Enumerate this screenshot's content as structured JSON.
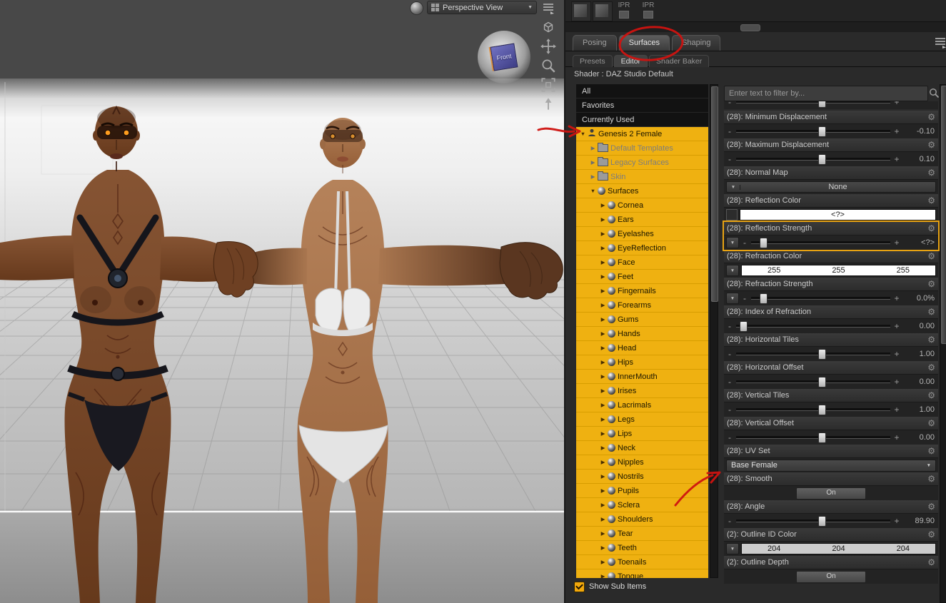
{
  "viewport": {
    "view_label": "Perspective View",
    "cube_label": "Front",
    "tools": [
      "cube-control",
      "pan",
      "zoom",
      "frame",
      "aim"
    ]
  },
  "toolbar": {
    "ipr_buttons": [
      "IPR",
      "IPR"
    ]
  },
  "tabs": [
    {
      "label": "Posing",
      "active": false
    },
    {
      "label": "Surfaces",
      "active": true
    },
    {
      "label": "Shaping",
      "active": false
    }
  ],
  "subtabs": [
    {
      "label": "Presets",
      "active": false
    },
    {
      "label": "Editor",
      "active": true
    },
    {
      "label": "Shader Baker",
      "active": false
    }
  ],
  "shader_label": "Shader : DAZ Studio Default",
  "filter_placeholder": "Enter text to filter by...",
  "tree": {
    "filters": [
      "All",
      "Favorites",
      "Currently Used"
    ],
    "root_label": "Genesis 2 Female",
    "groups": [
      "Default Templates",
      "Legacy Surfaces",
      "Skin"
    ],
    "surfaces_label": "Surfaces",
    "surfaces": [
      "Cornea",
      "Ears",
      "Eyelashes",
      "EyeReflection",
      "Face",
      "Feet",
      "Fingernails",
      "Forearms",
      "Gums",
      "Hands",
      "Head",
      "Hips",
      "InnerMouth",
      "Irises",
      "Lacrimals",
      "Legs",
      "Lips",
      "Neck",
      "Nipples",
      "Nostrils",
      "Pupils",
      "Sclera",
      "Shoulders",
      "Tear",
      "Teeth",
      "Toenails",
      "Tongue"
    ],
    "show_sub_items": "Show Sub Items"
  },
  "params": [
    {
      "label": "(28): Minimum Displacement",
      "type": "slider",
      "value": "-0.10",
      "pct": 55
    },
    {
      "label": "(28): Maximum Displacement",
      "type": "slider",
      "value": "0.10",
      "pct": 55
    },
    {
      "label": "(28): Normal Map",
      "type": "dropdown",
      "value": "None"
    },
    {
      "label": "(28): Reflection Color",
      "type": "color",
      "value": "<?>",
      "swatch": "#ffffff"
    },
    {
      "label": "(28): Reflection Strength",
      "type": "sliderdrop",
      "value": "<?>",
      "pct": 8,
      "highlight": true
    },
    {
      "label": "(28): Refraction Color",
      "type": "color3",
      "values": [
        "255",
        "255",
        "255"
      ],
      "swatch": "#ffffff"
    },
    {
      "label": "(28): Refraction Strength",
      "type": "sliderdrop",
      "value": "0.0%",
      "pct": 8
    },
    {
      "label": "(28): Index of Refraction",
      "type": "slider",
      "value": "0.00",
      "pct": 4
    },
    {
      "label": "(28): Horizontal Tiles",
      "type": "slider",
      "value": "1.00",
      "pct": 55
    },
    {
      "label": "(28): Horizontal Offset",
      "type": "slider",
      "value": "0.00",
      "pct": 55
    },
    {
      "label": "(28): Vertical Tiles",
      "type": "slider",
      "value": "1.00",
      "pct": 55
    },
    {
      "label": "(28): Vertical Offset",
      "type": "slider",
      "value": "0.00",
      "pct": 55
    },
    {
      "label": "(28): UV Set",
      "type": "select",
      "value": "Base Female"
    },
    {
      "label": "(28): Smooth",
      "type": "toggle",
      "value": "On"
    },
    {
      "label": "(28): Angle",
      "type": "slider",
      "value": "89.90",
      "pct": 55
    },
    {
      "label": "(2): Outline ID Color",
      "type": "color3",
      "values": [
        "204",
        "204",
        "204"
      ],
      "swatch": "#cccccc"
    },
    {
      "label": "(2): Outline Depth",
      "type": "toggle",
      "value": "On"
    }
  ],
  "colors": {
    "tree_highlight": "#efb111",
    "param_highlight_border": "#e8a312",
    "annotation_red": "#cf1310",
    "panel_bg": "#2a2a2a"
  },
  "annotations": [
    "circle-surfaces-tab",
    "arrow-genesis-2-female",
    "arrow-uv-base-female"
  ]
}
